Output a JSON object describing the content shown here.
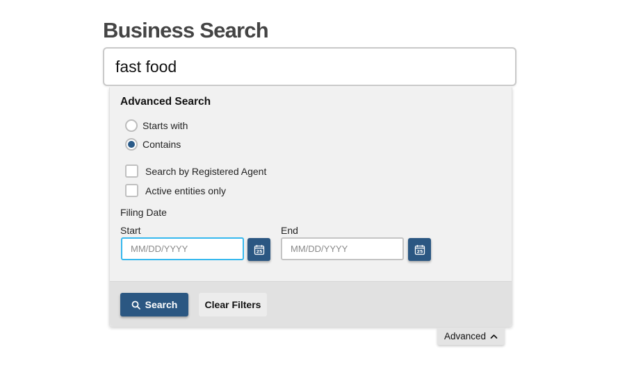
{
  "page": {
    "title": "Business Search"
  },
  "search": {
    "value": "fast food",
    "placeholder": ""
  },
  "advanced": {
    "heading": "Advanced Search",
    "match_mode": {
      "options": [
        {
          "label": "Starts with",
          "checked": false
        },
        {
          "label": "Contains",
          "checked": true
        }
      ]
    },
    "checkboxes": [
      {
        "label": "Search by Registered Agent",
        "checked": false
      },
      {
        "label": "Active entities only",
        "checked": false
      }
    ],
    "filing_date": {
      "label": "Filing Date",
      "start": {
        "label": "Start",
        "value": "",
        "placeholder": "MM/DD/YYYY",
        "calendar_icon": "calendar-icon",
        "calendar_day": "25"
      },
      "end": {
        "label": "End",
        "value": "",
        "placeholder": "MM/DD/YYYY",
        "calendar_icon": "calendar-icon",
        "calendar_day": "25"
      }
    },
    "buttons": {
      "search_label": "Search",
      "search_icon": "search-icon",
      "clear_label": "Clear Filters"
    },
    "toggle": {
      "label": "Advanced",
      "icon": "chevron-up-icon"
    }
  },
  "colors": {
    "primary": "#2b5782",
    "focus": "#35b8ee",
    "panel_bg": "#f1f1f1",
    "footer_bg": "#e1e1e1"
  }
}
